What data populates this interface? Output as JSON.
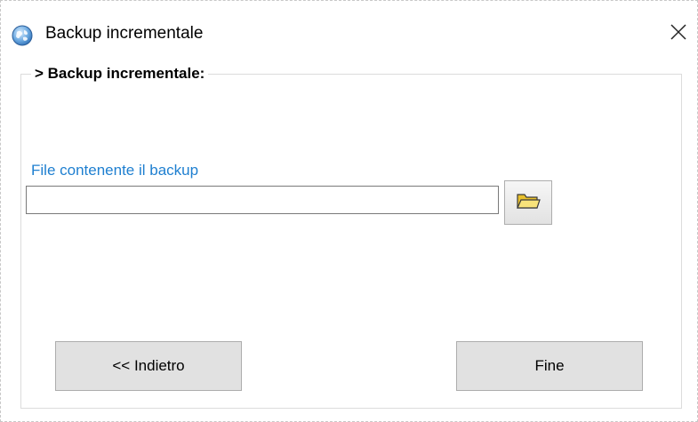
{
  "window": {
    "title": "Backup incrementale",
    "app_icon": "globe-app-icon",
    "close_icon": "close-icon"
  },
  "group": {
    "title": "> Backup incrementale:"
  },
  "file_field": {
    "label": "File contenente il backup",
    "value": "",
    "browse_icon": "folder-open-icon"
  },
  "buttons": {
    "back_label": "<< Indietro",
    "finish_label": "Fine"
  },
  "colors": {
    "label_blue": "#1e7fd0",
    "button_face": "#e1e1e1",
    "folder_yellow": "#f2d23a"
  }
}
